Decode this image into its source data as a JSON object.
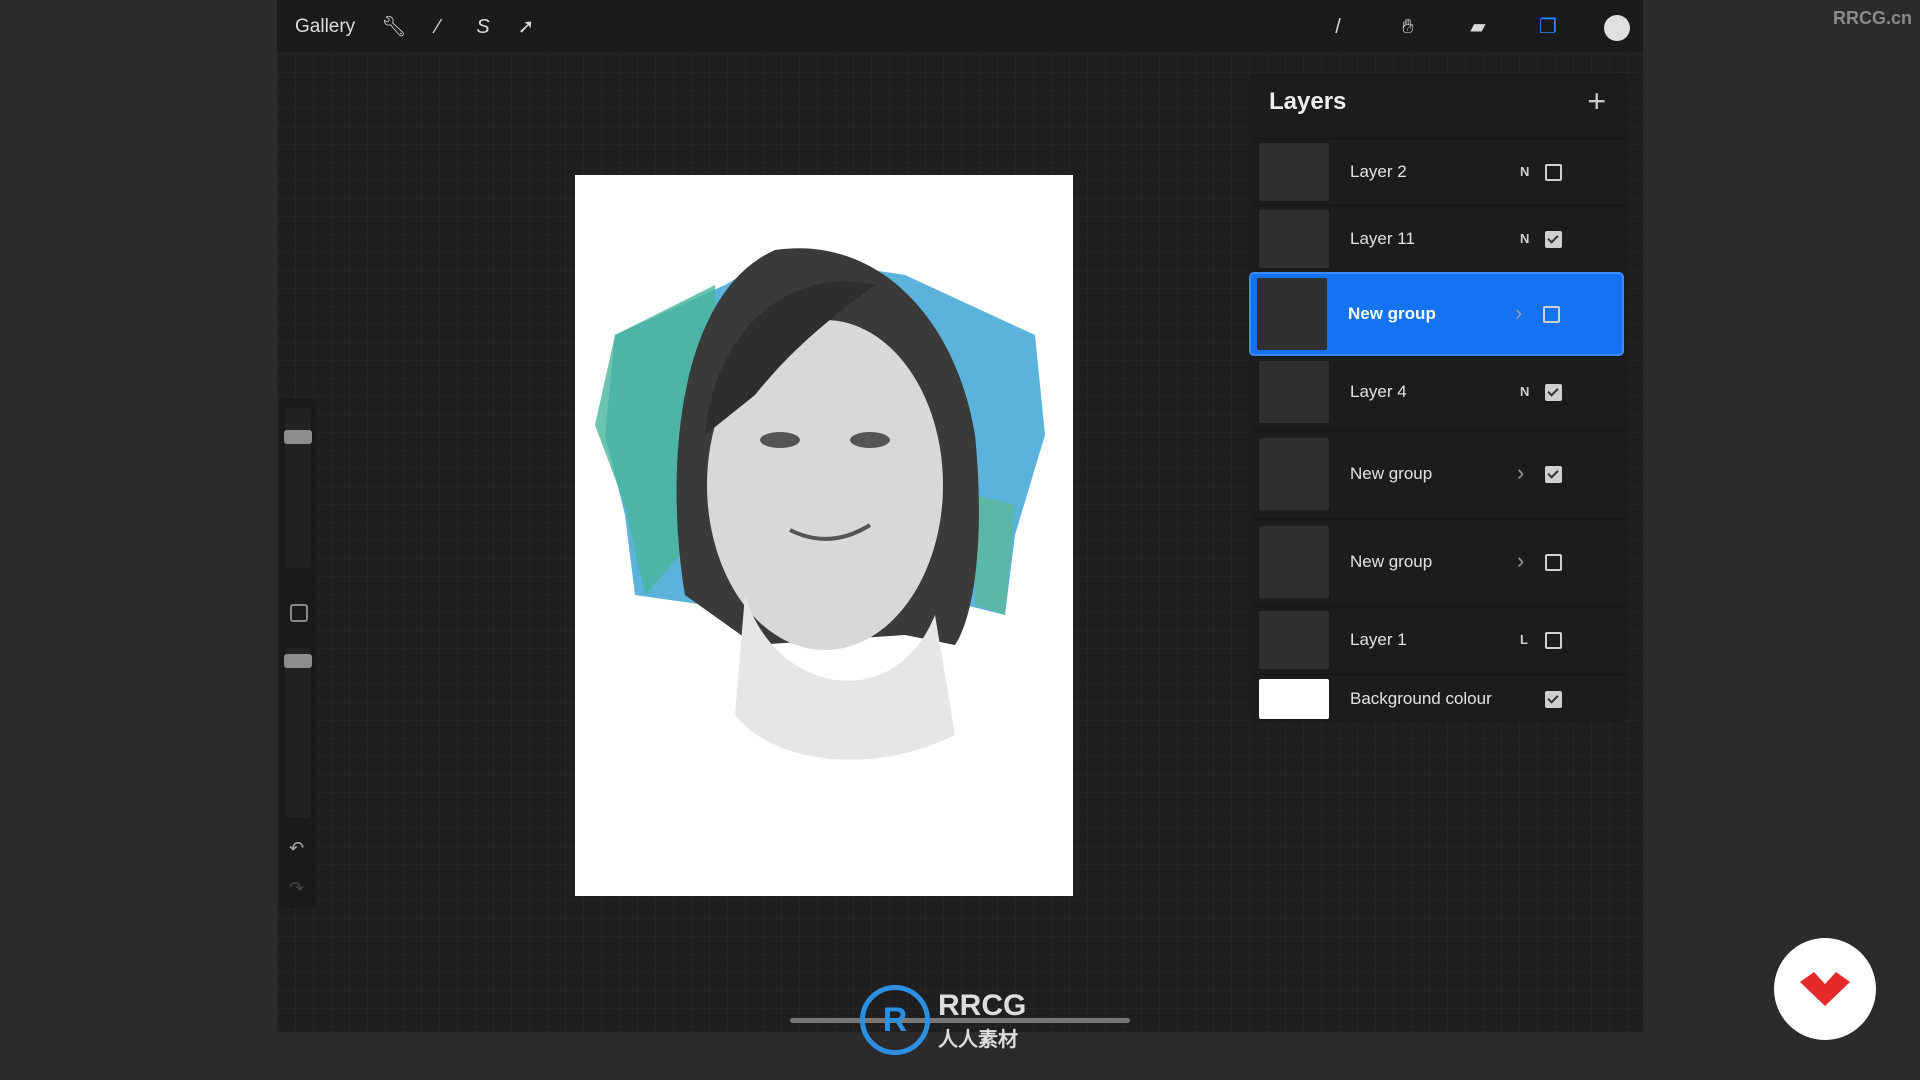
{
  "toolbar": {
    "gallery": "Gallery",
    "left_icons": [
      "wrench-icon",
      "magic-wand-icon",
      "selection-icon",
      "transform-arrow-icon"
    ],
    "right_icons": [
      "brush-icon",
      "smudge-icon",
      "eraser-icon",
      "layers-icon",
      "color-swatch-icon"
    ],
    "current_color": "#e0e0e0"
  },
  "layers": {
    "title": "Layers",
    "items": [
      {
        "name": "Layer 2",
        "mode": "N",
        "visible": false,
        "group": false,
        "selected": false
      },
      {
        "name": "Layer 11",
        "mode": "N",
        "visible": true,
        "group": false,
        "selected": false
      },
      {
        "name": "New group",
        "mode": "",
        "visible": false,
        "group": true,
        "selected": true
      },
      {
        "name": "Layer 4",
        "mode": "N",
        "visible": true,
        "group": false,
        "selected": false
      },
      {
        "name": "New group",
        "mode": "",
        "visible": true,
        "group": true,
        "selected": false
      },
      {
        "name": "New group",
        "mode": "",
        "visible": false,
        "group": true,
        "selected": false
      },
      {
        "name": "Layer 1",
        "mode": "L",
        "visible": false,
        "group": false,
        "selected": false
      },
      {
        "name": "Background colour",
        "mode": "",
        "visible": true,
        "group": false,
        "selected": false
      }
    ]
  },
  "watermark": "RRCG.cn",
  "logo": {
    "line1": "RRCG",
    "line2": "人人素材"
  },
  "accent": "#1473f5"
}
